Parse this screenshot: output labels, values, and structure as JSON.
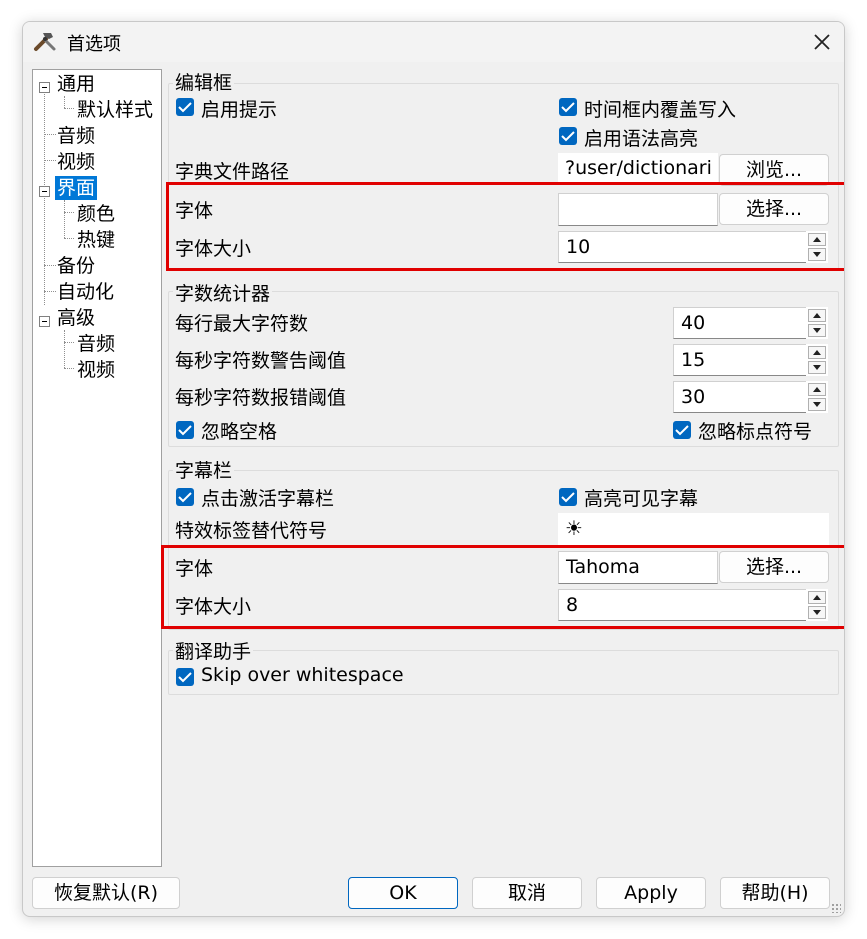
{
  "window": {
    "title": "首选项"
  },
  "tree": {
    "items": [
      {
        "label": "通用"
      },
      {
        "label": "默认样式"
      },
      {
        "label": "音频"
      },
      {
        "label": "视频"
      },
      {
        "label": "界面"
      },
      {
        "label": "颜色"
      },
      {
        "label": "热键"
      },
      {
        "label": "备份"
      },
      {
        "label": "自动化"
      },
      {
        "label": "高级"
      },
      {
        "label": "音频"
      },
      {
        "label": "视频"
      }
    ],
    "selected": "界面"
  },
  "editbox": {
    "title": "编辑框",
    "enable_hints": "启用提示",
    "timebox_overwrite": "时间框内覆盖写入",
    "syntax_highlight": "启用语法高亮",
    "dict_path_label": "字典文件路径",
    "dict_path_value": "?user/dictionari",
    "browse": "浏览...",
    "font_label": "字体",
    "font_value": "",
    "choose": "选择...",
    "font_size_label": "字体大小",
    "font_size_value": "10"
  },
  "counter": {
    "title": "字数统计器",
    "max_chars_label": "每行最大字符数",
    "max_chars_value": "40",
    "cps_warn_label": "每秒字符数警告阈值",
    "cps_warn_value": "15",
    "cps_error_label": "每秒字符数报错阈值",
    "cps_error_value": "30",
    "ignore_spaces": "忽略空格",
    "ignore_punct": "忽略标点符号"
  },
  "subgrid": {
    "title": "字幕栏",
    "click_activate": "点击激活字幕栏",
    "highlight_visible": "高亮可见字幕",
    "fx_tag_label": "特效标签替代符号",
    "fx_tag_value": "☀",
    "font_label": "字体",
    "font_value": "Tahoma",
    "choose": "选择...",
    "font_size_label": "字体大小",
    "font_size_value": "8"
  },
  "translation": {
    "title": "翻译助手",
    "skip_whitespace": "Skip over whitespace"
  },
  "footer": {
    "restore": "恢复默认(R)",
    "ok": "OK",
    "cancel": "取消",
    "apply": "Apply",
    "help": "帮助(H)"
  },
  "colors": {
    "accent": "#0067c0",
    "selection": "#0078d7",
    "highlight_box": "#e00000"
  }
}
